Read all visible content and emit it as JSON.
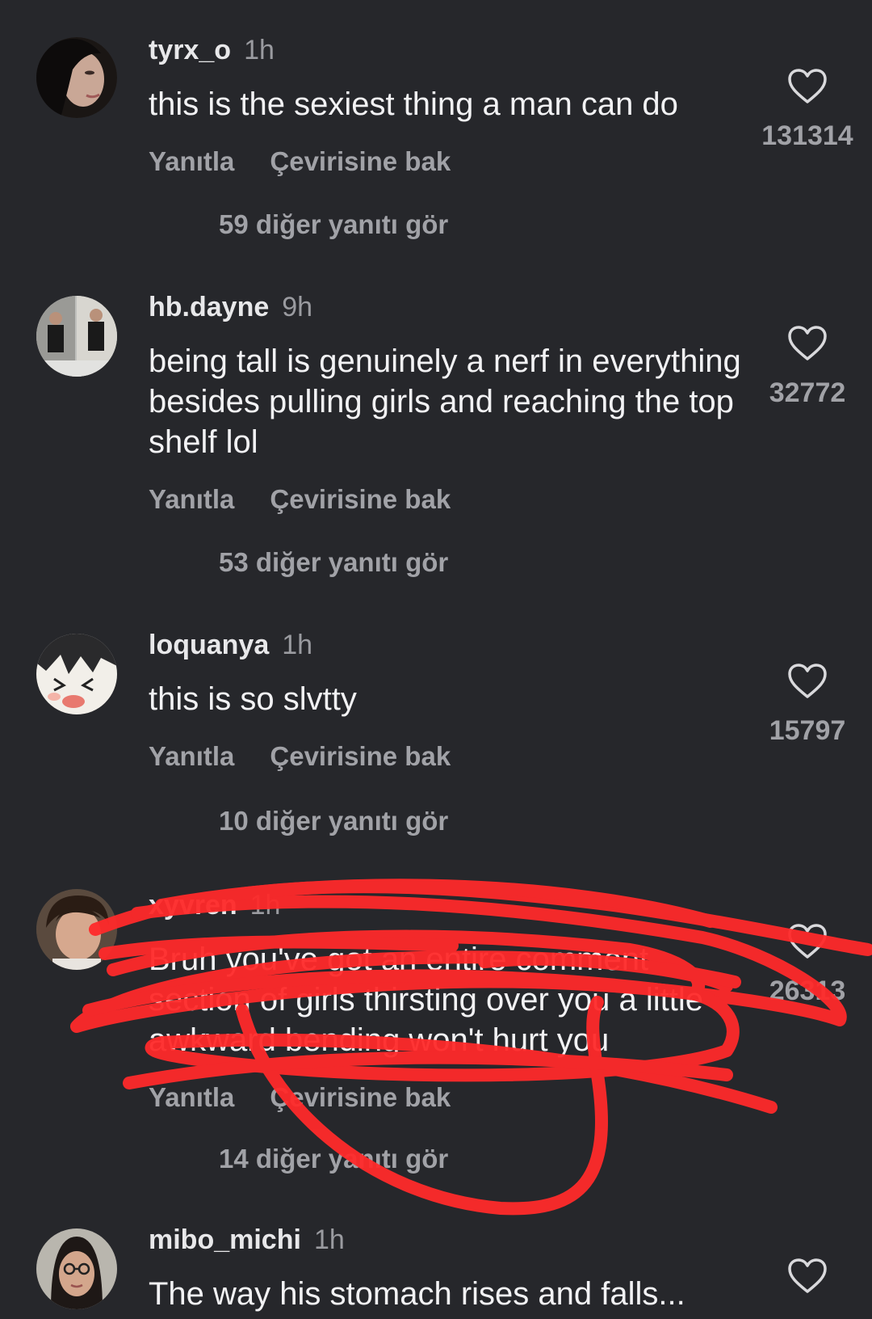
{
  "comments": [
    {
      "username": "tyrx_o",
      "time": "1h",
      "text": "this is the sexiest thing a man can do",
      "reply_label": "Yanıtla",
      "translate_label": "Çevirisine bak",
      "likes": "131314",
      "more_replies": "59 diğer yanıtı gör"
    },
    {
      "username": "hb.dayne",
      "time": "9h",
      "text": "being tall is genuinely a nerf in everything besides pulling girls and reaching the top shelf lol",
      "reply_label": "Yanıtla",
      "translate_label": "Çevirisine bak",
      "likes": "32772",
      "more_replies": "53 diğer yanıtı gör"
    },
    {
      "username": "loquanya",
      "time": "1h",
      "text": "this is so slvtty",
      "reply_label": "Yanıtla",
      "translate_label": "Çevirisine bak",
      "likes": "15797",
      "more_replies": "10 diğer yanıtı gör"
    },
    {
      "username": "xyvren",
      "time": "1h",
      "text": "Bruh you've got an entire comment section of girls thirsting over you a little awkward bending won't hurt you",
      "reply_label": "Yanıtla",
      "translate_label": "Çevirisine bak",
      "likes": "26313",
      "more_replies": "14 diğer yanıtı gör"
    },
    {
      "username": "mibo_michi",
      "time": "1h",
      "text": "The way his stomach rises and falls...",
      "likes": ""
    }
  ],
  "colors": {
    "background": "#26272b",
    "username": "#e8e8ea",
    "secondary_text": "#a1a2a7",
    "scribble": "#ff2a2a"
  },
  "icons": {
    "like": "heart-outline-icon"
  }
}
